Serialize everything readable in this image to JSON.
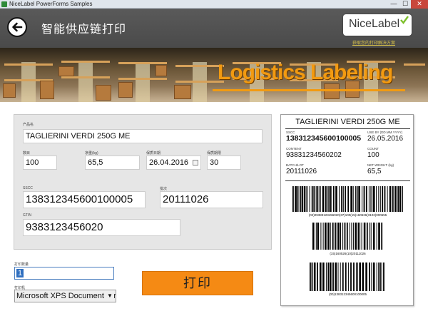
{
  "window": {
    "title": "NiceLabel PowerForms Samples",
    "minimize": "—",
    "maximize": "☐",
    "close": "✕"
  },
  "header": {
    "title": "智能供应链打印",
    "logo_text": "NiceLabel",
    "logo_link": "获取您的打印解决方案"
  },
  "banner": {
    "text": "Logistics Labeling"
  },
  "form": {
    "product_name_label": "产品名",
    "product_name_value": "TAGLIERINI VERDI 250G ME",
    "count_label": "数目",
    "count_value": "100",
    "weight_label": "净重(kg)",
    "weight_value": "65,5",
    "date_label": "保质日期",
    "date_value": "26.04.2016",
    "days_label": "保质期限",
    "days_value": "30",
    "sscc_label": "SSCC",
    "sscc_value": "138312345600100005",
    "batch_label": "批次",
    "batch_value": "20111026",
    "gtin_label": "GTIN",
    "gtin_value": "9383123456020"
  },
  "controls": {
    "quantity_label": "打印数量",
    "quantity_value": "1",
    "printer_label": "打印机",
    "printer_value": "Microsoft XPS Document Writer",
    "print_button": "打印"
  },
  "label_preview": {
    "title": "TAGLIERINI VERDI 250G ME",
    "sscc_label": "SSCC",
    "sscc_value": "138312345600100005",
    "useby_label": "USE BY (DD.MM.YYYY)",
    "useby_value": "26.05.2016",
    "content_label": "CONTENT",
    "content_value": "93831234560202",
    "count_label": "COUNT",
    "count_value": "100",
    "batch_label": "BATCH/LOT",
    "batch_value": "20111026",
    "weight_label": "NET WEIGHT (kg)",
    "weight_value": "65,5",
    "barcode1_text": "(02)09383123456020(37)100(15)160526(3102)000655",
    "barcode2_text": "(15)160526(10)20111026",
    "barcode3_text": "(00)138312345600100005"
  },
  "colors": {
    "accent_orange": "#f58a14",
    "banner_text": "#f29a11",
    "header_bg": "#525252",
    "panel_bg": "#e6e6e6"
  }
}
